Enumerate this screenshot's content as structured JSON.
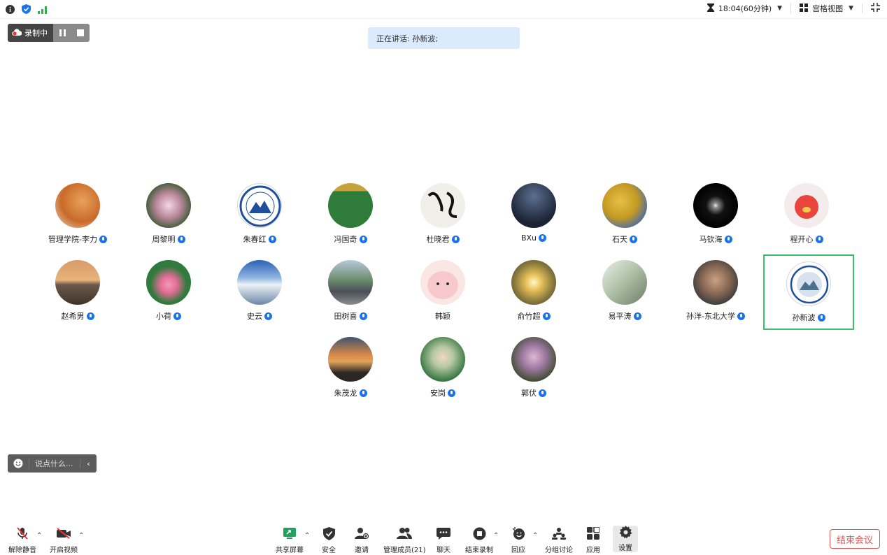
{
  "topbar": {
    "timer": "18:04(60分钟)",
    "view_label": "宫格视图"
  },
  "recording": {
    "label": "录制中"
  },
  "speaking": {
    "text": "正在讲话: 孙新波;"
  },
  "participants": [
    {
      "name": "管理学院-李力"
    },
    {
      "name": "周黎明"
    },
    {
      "name": "朱春红"
    },
    {
      "name": "冯国奇"
    },
    {
      "name": "杜晓君"
    },
    {
      "name": "BXu"
    },
    {
      "name": "石天"
    },
    {
      "name": "马钦海"
    },
    {
      "name": "程开心"
    },
    {
      "name": "赵希男"
    },
    {
      "name": "小荷"
    },
    {
      "name": "史云"
    },
    {
      "name": "田树喜"
    },
    {
      "name": "韩颖"
    },
    {
      "name": "俞竹超"
    },
    {
      "name": "易平涛"
    },
    {
      "name": "孙洋-东北大学"
    },
    {
      "name": "孙新波"
    },
    {
      "name": "朱茂龙"
    },
    {
      "name": "安岗"
    },
    {
      "name": "郭伏"
    }
  ],
  "chat": {
    "placeholder": "说点什么..."
  },
  "toolbar": {
    "unmute": "解除静音",
    "start_video": "开启视频",
    "share_screen": "共享屏幕",
    "security": "安全",
    "invite": "邀请",
    "manage_members": "管理成员(21)",
    "chat": "聊天",
    "end_recording": "结束录制",
    "reaction": "回应",
    "breakout": "分组讨论",
    "apps": "应用",
    "settings": "设置",
    "end_meeting": "结束会议"
  },
  "colors": {
    "accent": "#1a73e8",
    "active_border": "#3bbf6a",
    "end": "#e25555",
    "share": "#22a060"
  }
}
